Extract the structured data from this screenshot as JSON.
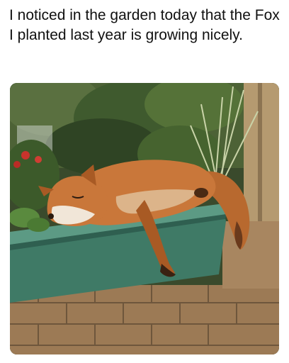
{
  "post": {
    "caption": "I noticed  in the garden today that the Fox I planted last year is growing nicely."
  },
  "photo": {
    "subject": "fox-sleeping-in-planter",
    "colors": {
      "fox_fur": "#c9773a",
      "planter": "#3f7a66",
      "brick": "#9c7a55",
      "foliage": "#3d5a2c"
    }
  }
}
